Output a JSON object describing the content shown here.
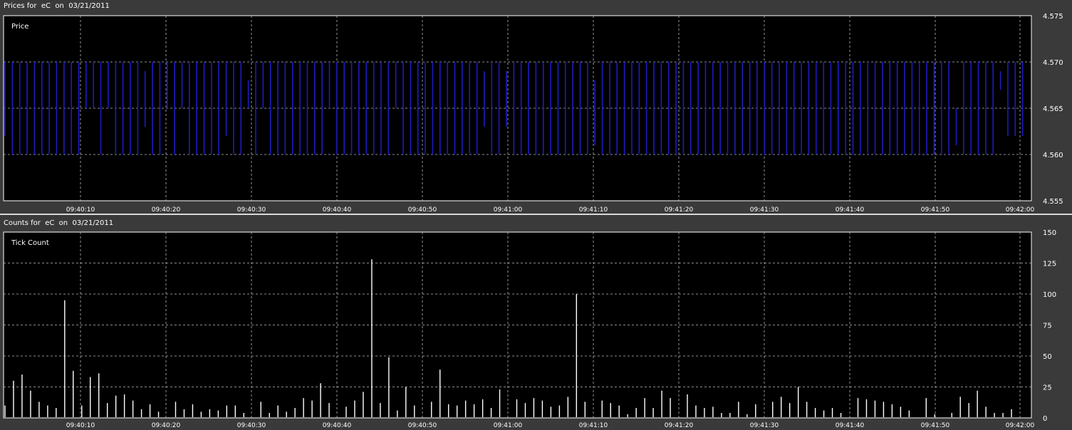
{
  "window": {
    "price_title": "Prices for  eC  on  03/21/2011",
    "count_title": "Counts for  eC  on  03/21/2011"
  },
  "colors": {
    "background": "#000000",
    "frame": "#3a3a3a",
    "price_bar": "#1c1cc0",
    "count_bar": "#ffffff",
    "grid": "#bbbbbb"
  },
  "chart_data": [
    {
      "type": "bar",
      "title": "Price",
      "x_ticks": [
        "09:40:10",
        "09:40:20",
        "09:40:30",
        "09:40:40",
        "09:40:50",
        "09:41:00",
        "09:41:10",
        "09:41:20",
        "09:41:30",
        "09:41:40",
        "09:41:50",
        "09:42:00"
      ],
      "ylim": [
        4.555,
        4.575
      ],
      "y_ticks": [
        "4.575",
        "4.570",
        "4.565",
        "4.560",
        "4.555"
      ],
      "grid": true,
      "series": [
        {
          "high": [
            4.57,
            4.57,
            4.57,
            4.57,
            4.57,
            4.57,
            4.57,
            4.57,
            4.57,
            4.57,
            4.57,
            4.57,
            4.57,
            4.57,
            4.57,
            4.57,
            4.57,
            4.57,
            4.57,
            4.569,
            4.57,
            4.57,
            4.57,
            4.57,
            4.57,
            4.57,
            4.57,
            4.57,
            4.57,
            4.57,
            4.57,
            4.57,
            4.57,
            4.568,
            4.57,
            4.57,
            4.57,
            4.57,
            4.57,
            4.57,
            4.57,
            4.57,
            4.57,
            4.57,
            4.57,
            4.57,
            4.57,
            4.57,
            4.57,
            4.57,
            4.57,
            4.57,
            4.57,
            4.57,
            4.57,
            4.57,
            4.57,
            4.57,
            4.57,
            4.57,
            4.57,
            4.57,
            4.57,
            4.57,
            4.57,
            4.569,
            4.57,
            4.57,
            4.569,
            4.57,
            4.57,
            4.57,
            4.57,
            4.57,
            4.57,
            4.57,
            4.57,
            4.57,
            4.57,
            4.57,
            4.568,
            4.57,
            4.57,
            4.57,
            4.57,
            4.57,
            4.57,
            4.57,
            4.57,
            4.57,
            4.57,
            4.57,
            4.57,
            4.57,
            4.57,
            4.57,
            4.57,
            4.57,
            4.57,
            4.57,
            4.57,
            4.57,
            4.57,
            4.57,
            4.57,
            4.57,
            4.57,
            4.57,
            4.57,
            4.57,
            4.57,
            4.57,
            4.57,
            4.57,
            4.57,
            4.57,
            4.57,
            4.57,
            4.57,
            4.57,
            4.57,
            4.57,
            4.57,
            4.57,
            4.57,
            4.57,
            4.57,
            4.57,
            4.57,
            4.565,
            4.57,
            4.57,
            4.57,
            4.57,
            4.57,
            4.569,
            4.57,
            4.57,
            4.57
          ],
          "low": [
            4.562,
            4.56,
            4.56,
            4.56,
            4.56,
            4.56,
            4.56,
            4.56,
            4.56,
            4.56,
            4.56,
            4.565,
            4.565,
            4.56,
            4.565,
            4.56,
            4.56,
            4.56,
            4.56,
            4.563,
            4.56,
            4.56,
            4.565,
            4.56,
            4.565,
            4.56,
            4.56,
            4.56,
            4.56,
            4.56,
            4.562,
            4.56,
            4.56,
            4.565,
            4.56,
            4.565,
            4.56,
            4.56,
            4.56,
            4.56,
            4.56,
            4.56,
            4.56,
            4.56,
            4.565,
            4.56,
            4.56,
            4.56,
            4.56,
            4.56,
            4.56,
            4.56,
            4.56,
            4.565,
            4.56,
            4.56,
            4.56,
            4.56,
            4.56,
            4.56,
            4.56,
            4.56,
            4.56,
            4.56,
            4.56,
            4.563,
            4.56,
            4.56,
            4.563,
            4.56,
            4.56,
            4.56,
            4.56,
            4.56,
            4.56,
            4.56,
            4.56,
            4.56,
            4.56,
            4.56,
            4.561,
            4.56,
            4.56,
            4.56,
            4.56,
            4.56,
            4.56,
            4.56,
            4.56,
            4.56,
            4.56,
            4.56,
            4.56,
            4.56,
            4.56,
            4.56,
            4.56,
            4.56,
            4.56,
            4.56,
            4.56,
            4.56,
            4.56,
            4.56,
            4.56,
            4.56,
            4.56,
            4.56,
            4.56,
            4.56,
            4.56,
            4.56,
            4.56,
            4.56,
            4.56,
            4.56,
            4.56,
            4.56,
            4.56,
            4.56,
            4.56,
            4.56,
            4.56,
            4.56,
            4.56,
            4.56,
            4.56,
            4.56,
            4.56,
            4.561,
            4.56,
            4.56,
            4.56,
            4.56,
            4.56,
            4.567,
            4.562,
            4.562,
            4.562
          ]
        }
      ]
    },
    {
      "type": "bar",
      "title": "Tick Count",
      "x_ticks": [
        "09:40:10",
        "09:40:20",
        "09:40:30",
        "09:40:40",
        "09:40:50",
        "09:41:00",
        "09:41:10",
        "09:41:20",
        "09:41:30",
        "09:41:40",
        "09:41:50",
        "09:42:00"
      ],
      "ylim": [
        0,
        150
      ],
      "y_ticks": [
        "150",
        "125",
        "100",
        "75",
        "50",
        "25",
        "0"
      ],
      "grid": true,
      "series": [
        {
          "values": [
            10,
            30,
            35,
            22,
            13,
            10,
            8,
            95,
            38,
            10,
            33,
            36,
            12,
            18,
            19,
            14,
            7,
            11,
            5,
            0,
            13,
            7,
            11,
            5,
            7,
            6,
            10,
            10,
            4,
            0,
            13,
            4,
            10,
            5,
            8,
            16,
            14,
            28,
            12,
            0,
            9,
            14,
            21,
            128,
            12,
            49,
            6,
            25,
            10,
            0,
            13,
            39,
            11,
            10,
            14,
            11,
            15,
            8,
            23,
            0,
            15,
            12,
            16,
            14,
            9,
            10,
            17,
            100,
            13,
            0,
            14,
            12,
            10,
            3,
            8,
            16,
            8,
            22,
            16,
            0,
            19,
            10,
            8,
            9,
            4,
            4,
            13,
            3,
            11,
            0,
            13,
            17,
            12,
            25,
            13,
            8,
            6,
            8,
            4,
            0,
            16,
            15,
            14,
            13,
            11,
            9,
            6,
            0,
            16,
            3,
            0,
            4,
            17,
            12,
            22,
            9,
            4,
            4,
            7,
            0
          ]
        }
      ]
    }
  ]
}
